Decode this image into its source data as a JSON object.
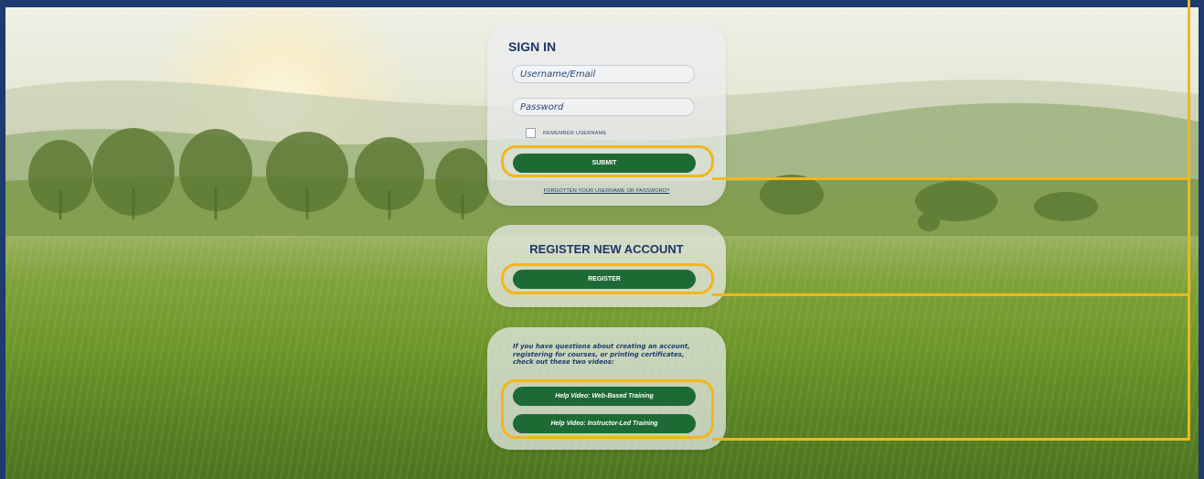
{
  "signin": {
    "title": "SIGN IN",
    "username_placeholder": "Username/Email",
    "password_placeholder": "Password",
    "remember_label": "REMEMBER USERNAME",
    "remember_checked": false,
    "submit_label": "SUBMIT",
    "forgot_link": "FORGOTTEN YOUR USERNAME OR PASSWORD?"
  },
  "register": {
    "title": "REGISTER NEW ACCOUNT",
    "button_label": "REGISTER"
  },
  "help": {
    "text": "If you have questions about creating an account, registering for courses, or printing certificates, check out these two videos:",
    "video1_label": "Help Video: Web-Based Training",
    "video2_label": "Help Video: Instructor-Led Training"
  },
  "colors": {
    "page_border": "#1e3a6e",
    "button_green": "#1d6a34",
    "heading_navy": "#1f3566",
    "highlight": "#f2b61c"
  }
}
